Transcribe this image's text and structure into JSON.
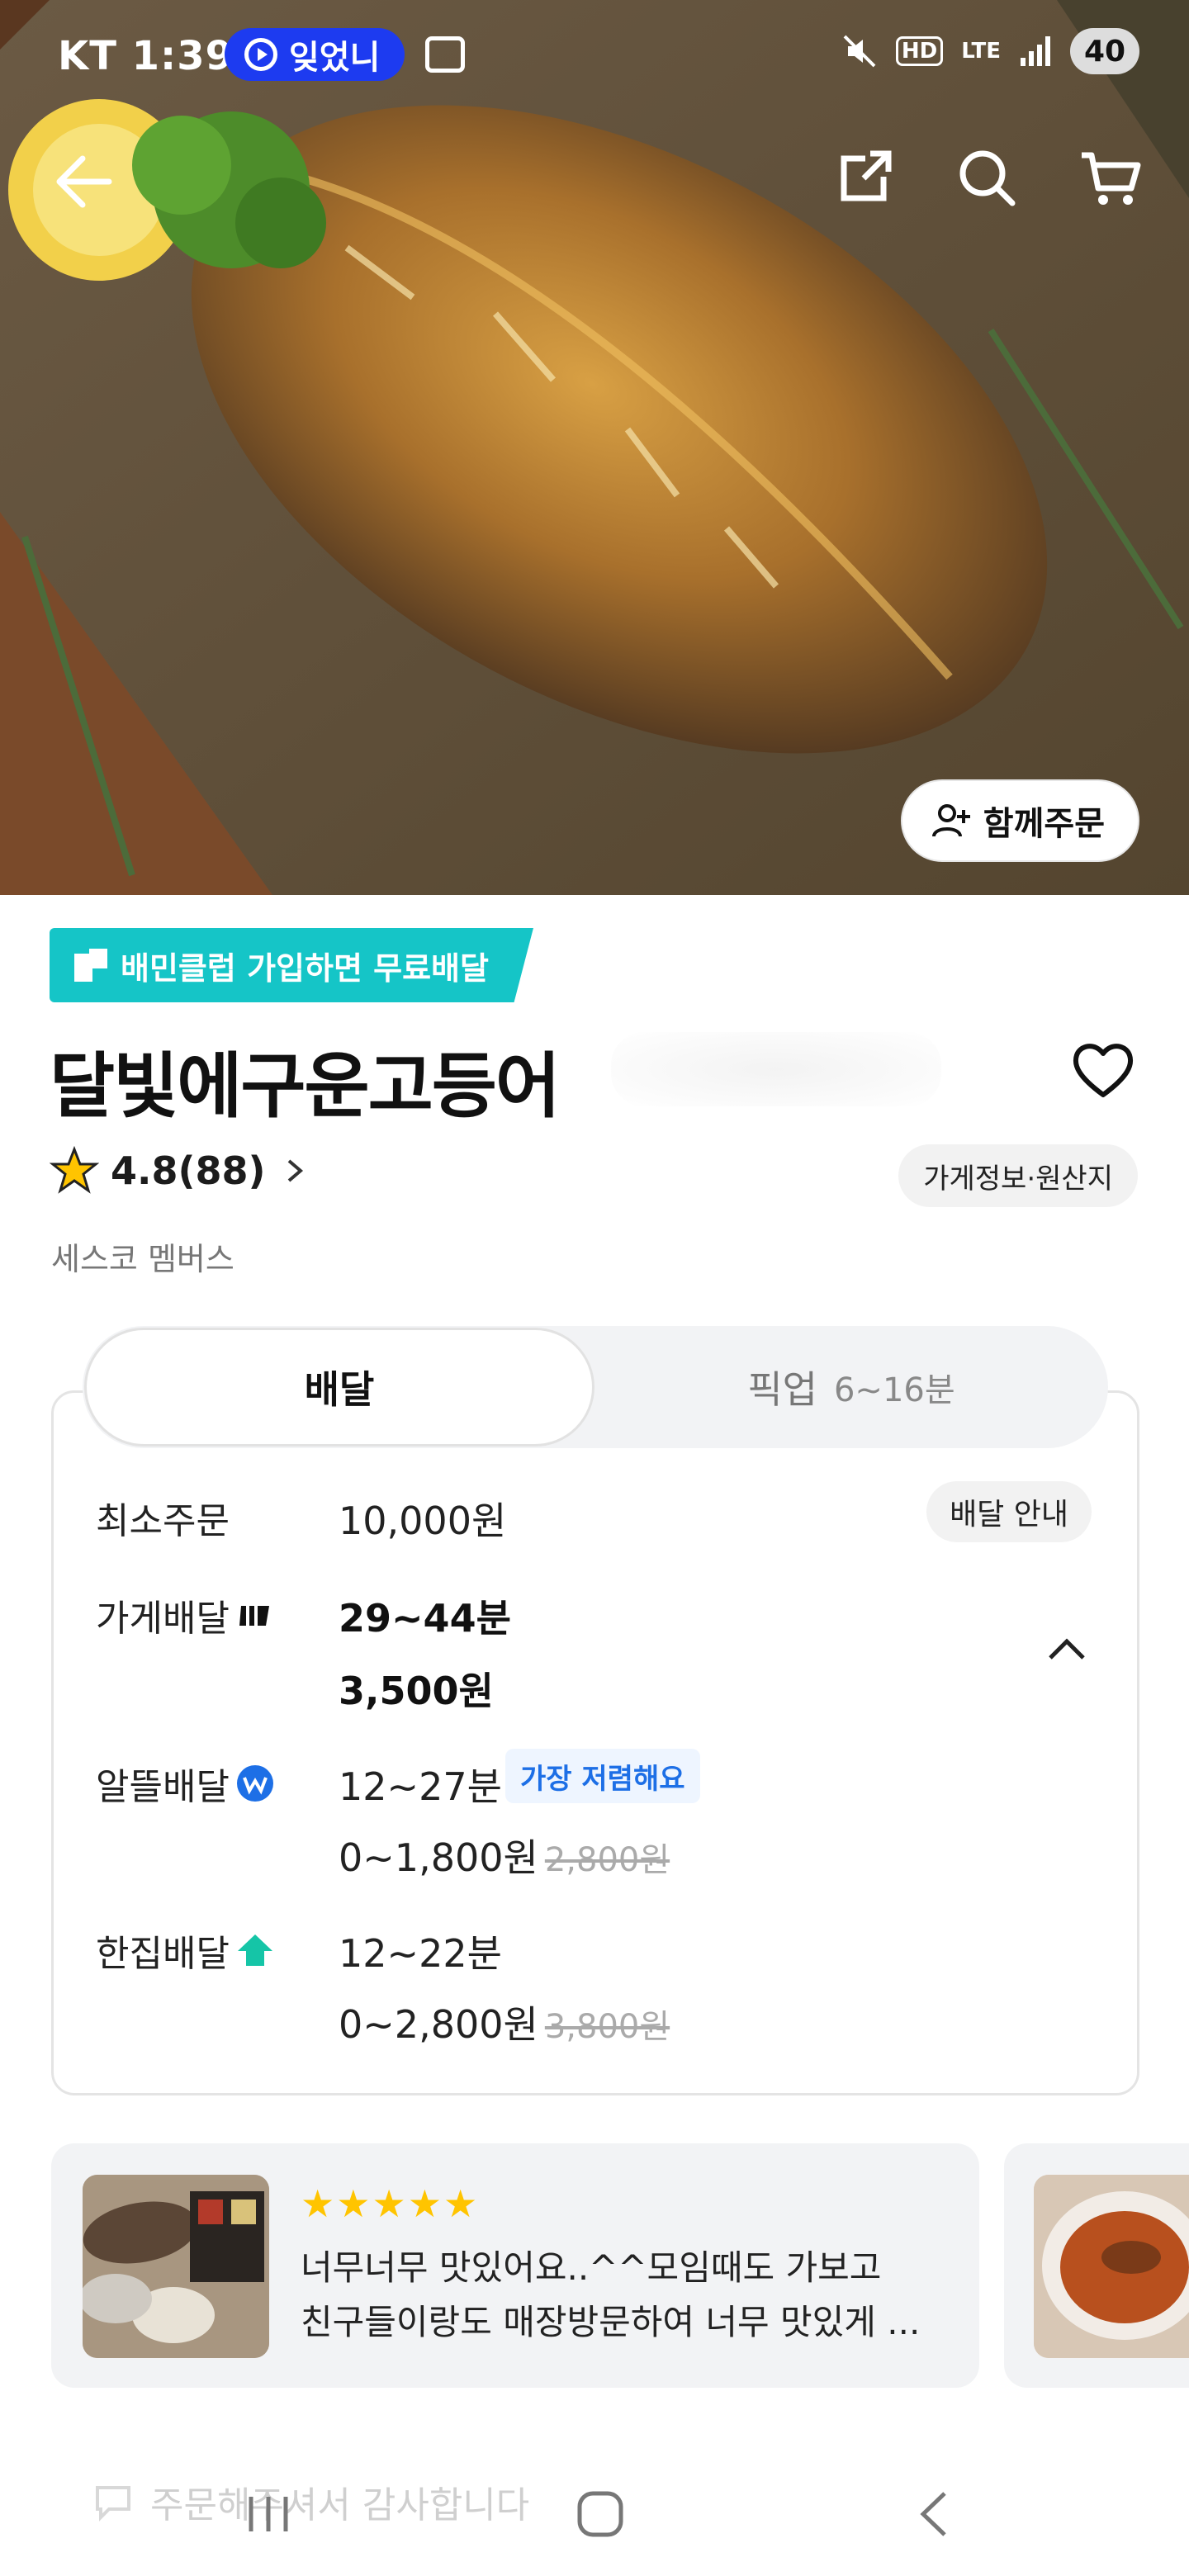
{
  "status_bar": {
    "carrier_time": "KT 1:39",
    "notification_pill": "잊었니",
    "network": "LTE",
    "hd": "HD",
    "battery": "40"
  },
  "hero": {
    "group_order_label": "함께주문"
  },
  "store": {
    "club_badge": "배민클럽 가입하면 무료배달",
    "name": "달빛에구운고등어",
    "rating": "4.8(88)",
    "info_button": "가게정보·원산지",
    "member_text": "세스코 멤버스"
  },
  "delivery": {
    "tab_delivery": "배달",
    "tab_pickup": "픽업",
    "pickup_time": "6~16분",
    "min_order_label": "최소주문",
    "min_order_value": "10,000원",
    "guide_button": "배달 안내",
    "store_delivery_label": "가게배달",
    "store_delivery_time": "29~44분",
    "store_delivery_fee": "3,500원",
    "saver_label": "알뜰배달",
    "saver_time": "12~27분",
    "saver_badge": "가장 저렴해요",
    "saver_fee": "0~1,800원",
    "saver_fee_original": "2,800원",
    "single_label": "한집배달",
    "single_time": "12~22분",
    "single_fee": "0~2,800원",
    "single_fee_original": "3,800원"
  },
  "review": {
    "stars": "★★★★★",
    "line1": "너무너무 맛있어요..^^모임때도 가보고",
    "line2": "친구들이랑도 매장방문하여 너무 맛있게 ..."
  },
  "bottom": {
    "ghost_message": "주문해주셔서 감사합니다"
  },
  "colors": {
    "club_teal": "#15c5c7",
    "saver_blue": "#1d6fe6",
    "star_yellow": "#ffc400",
    "pill_blue": "#1d3bf0"
  }
}
